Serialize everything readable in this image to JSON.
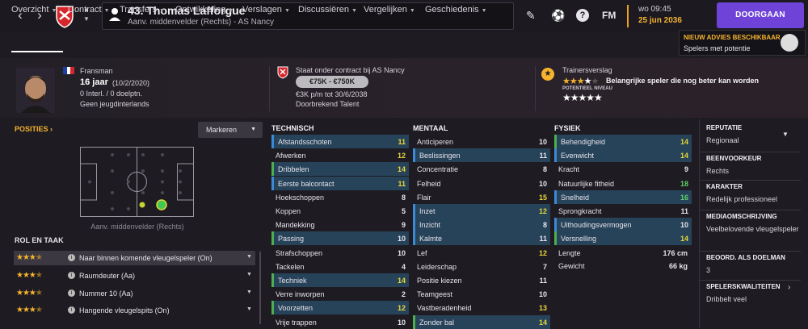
{
  "header": {
    "title": "43. Thomas Lafforgue",
    "subtitle": "Aanv. middenvelder (Rechts) - AS Nancy",
    "fm_label": "FM",
    "day": "wo 09:45",
    "date": "25 jun 2036",
    "continue_label": "DOORGAAN"
  },
  "tabs": [
    {
      "label": "Overzicht"
    },
    {
      "label": "Contract"
    },
    {
      "label": "Transfers"
    },
    {
      "label": "Ontwikkeling"
    },
    {
      "label": "Verslagen"
    },
    {
      "label": "Discussiëren"
    },
    {
      "label": "Vergelijken"
    },
    {
      "label": "Geschiedenis"
    }
  ],
  "advice": {
    "title": "NIEUW ADVIES BESCHIKBAAR",
    "text": "Spelers met potentie"
  },
  "player": {
    "nationality": "Fransman",
    "age": "16 jaar",
    "birthdate": "(10/2/2020)",
    "caps": "0 Interl. / 0 doelptn.",
    "youth": "Geen jeugdinterlands"
  },
  "contract": {
    "status": "Staat onder contract bij AS Nancy",
    "value": "€75K - €750K",
    "wage": "€3K p/m tot 30/6/2038",
    "status2": "Doorbrekend Talent"
  },
  "scout": {
    "label": "Trainersverslag",
    "current_stars": 3.5,
    "verdict": "Belangrijke speler die nog beter kan worden",
    "potential_label": "POTENTIEEL NIVEAU",
    "potential_stars": 4.5
  },
  "positions": {
    "title": "POSITIES",
    "dropdown": "Markeren",
    "pitch_label": "Aanv. middenvelder (Rechts)"
  },
  "roles": {
    "title": "ROL EN TAAK",
    "items": [
      {
        "stars": 3.5,
        "name": "Naar binnen komende vleugelspeler (On)"
      },
      {
        "stars": 3.5,
        "name": "Raumdeuter (Aa)"
      },
      {
        "stars": 3.5,
        "name": "Nummer 10 (Aa)"
      },
      {
        "stars": 3.5,
        "name": "Hangende vleugelspits (On)"
      }
    ]
  },
  "technical": {
    "title": "TECHNISCH",
    "items": [
      {
        "name": "Afstandsschoten",
        "value": "11",
        "color": "yellow",
        "hl": true,
        "mark": "blue"
      },
      {
        "name": "Afwerken",
        "value": "12",
        "color": "yellow",
        "hl": false,
        "mark": ""
      },
      {
        "name": "Dribbelen",
        "value": "14",
        "color": "yellow",
        "hl": true,
        "mark": "green"
      },
      {
        "name": "Eerste balcontact",
        "value": "11",
        "color": "yellow",
        "hl": true,
        "mark": "blue"
      },
      {
        "name": "Hoekschoppen",
        "value": "8",
        "color": "white",
        "hl": false,
        "mark": ""
      },
      {
        "name": "Koppen",
        "value": "5",
        "color": "white",
        "hl": false,
        "mark": ""
      },
      {
        "name": "Mandekking",
        "value": "9",
        "color": "white",
        "hl": false,
        "mark": ""
      },
      {
        "name": "Passing",
        "value": "10",
        "color": "white",
        "hl": true,
        "mark": "green"
      },
      {
        "name": "Strafschoppen",
        "value": "10",
        "color": "white",
        "hl": false,
        "mark": ""
      },
      {
        "name": "Tackelen",
        "value": "4",
        "color": "white",
        "hl": false,
        "mark": ""
      },
      {
        "name": "Techniek",
        "value": "14",
        "color": "yellow",
        "hl": true,
        "mark": "green"
      },
      {
        "name": "Verre inworpen",
        "value": "2",
        "color": "white",
        "hl": false,
        "mark": ""
      },
      {
        "name": "Voorzetten",
        "value": "12",
        "color": "yellow",
        "hl": true,
        "mark": "green"
      },
      {
        "name": "Vrije trappen",
        "value": "10",
        "color": "white",
        "hl": false,
        "mark": ""
      }
    ]
  },
  "mental": {
    "title": "MENTAAL",
    "items": [
      {
        "name": "Anticiperen",
        "value": "10",
        "color": "white",
        "hl": false,
        "mark": ""
      },
      {
        "name": "Beslissingen",
        "value": "11",
        "color": "white",
        "hl": true,
        "mark": "blue"
      },
      {
        "name": "Concentratie",
        "value": "8",
        "color": "white",
        "hl": false,
        "mark": ""
      },
      {
        "name": "Felheid",
        "value": "10",
        "color": "white",
        "hl": false,
        "mark": ""
      },
      {
        "name": "Flair",
        "value": "15",
        "color": "yellow",
        "hl": false,
        "mark": ""
      },
      {
        "name": "Inzet",
        "value": "12",
        "color": "yellow",
        "hl": true,
        "mark": "blue"
      },
      {
        "name": "Inzicht",
        "value": "8",
        "color": "white",
        "hl": true,
        "mark": "blue"
      },
      {
        "name": "Kalmte",
        "value": "11",
        "color": "white",
        "hl": true,
        "mark": "blue"
      },
      {
        "name": "Lef",
        "value": "12",
        "color": "yellow",
        "hl": false,
        "mark": ""
      },
      {
        "name": "Leiderschap",
        "value": "7",
        "color": "white",
        "hl": false,
        "mark": ""
      },
      {
        "name": "Positie kiezen",
        "value": "11",
        "color": "white",
        "hl": false,
        "mark": ""
      },
      {
        "name": "Teamgeest",
        "value": "10",
        "color": "white",
        "hl": false,
        "mark": ""
      },
      {
        "name": "Vastberadenheid",
        "value": "13",
        "color": "yellow",
        "hl": false,
        "mark": ""
      },
      {
        "name": "Zonder bal",
        "value": "14",
        "color": "yellow",
        "hl": true,
        "mark": "green"
      }
    ]
  },
  "physical": {
    "title": "FYSIEK",
    "items": [
      {
        "name": "Behendigheid",
        "value": "14",
        "color": "yellow",
        "hl": true,
        "mark": "green"
      },
      {
        "name": "Evenwicht",
        "value": "14",
        "color": "yellow",
        "hl": true,
        "mark": "blue"
      },
      {
        "name": "Kracht",
        "value": "9",
        "color": "white",
        "hl": false,
        "mark": ""
      },
      {
        "name": "Natuurlijke fitheid",
        "value": "18",
        "color": "green",
        "hl": false,
        "mark": ""
      },
      {
        "name": "Snelheid",
        "value": "16",
        "color": "green",
        "hl": true,
        "mark": "blue"
      },
      {
        "name": "Sprongkracht",
        "value": "11",
        "color": "white",
        "hl": false,
        "mark": ""
      },
      {
        "name": "Uithoudingsvermogen",
        "value": "10",
        "color": "white",
        "hl": true,
        "mark": "blue"
      },
      {
        "name": "Versnelling",
        "value": "14",
        "color": "yellow",
        "hl": true,
        "mark": "green"
      }
    ],
    "length_label": "Lengte",
    "length": "176 cm",
    "weight_label": "Gewicht",
    "weight": "66 kg"
  },
  "info": [
    {
      "head": "REPUTATIE",
      "value": "Regionaal"
    },
    {
      "head": "BEENVOORKEUR",
      "value": "Rechts"
    },
    {
      "head": "KARAKTER",
      "value": "Redelijk professioneel"
    },
    {
      "head": "MEDIAOMSCHRIJVING",
      "value": "Veelbelovende vleugelspeler"
    },
    {
      "head": "BEOORD. ALS DOELMAN",
      "value": "3"
    },
    {
      "head": "SPELERSKWALITEITEN",
      "value": "Dribbelt veel"
    }
  ],
  "colors": {
    "accent": "#f5b32e",
    "continue": "#6f43d8",
    "highlight_row": "#27435a",
    "good": "#5fd068",
    "yellow": "#e8d538"
  }
}
